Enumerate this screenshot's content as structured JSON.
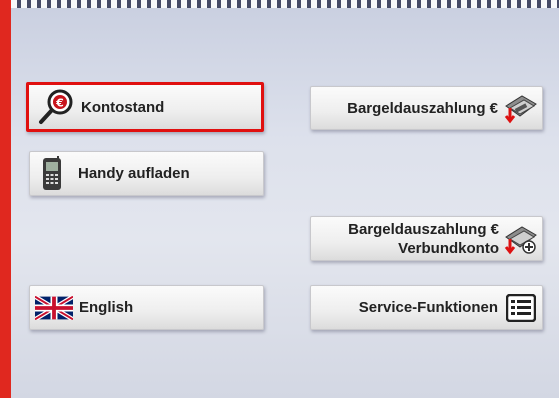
{
  "menu": {
    "kontostand": "Kontostand",
    "handy": "Handy aufladen",
    "english": "English",
    "bargeld": "Bargeldauszahlung €",
    "bargeld_verbund_line1": "Bargeldauszahlung €",
    "bargeld_verbund_line2": "Verbundkonto",
    "service": "Service-Funktionen"
  },
  "icons": {
    "kontostand": "magnifier-euro-icon",
    "handy": "mobile-phone-icon",
    "english": "uk-flag-icon",
    "bargeld": "cash-withdrawal-icon",
    "bargeld_verbund": "cash-withdrawal-linked-icon",
    "service": "list-icon"
  },
  "colors": {
    "selection": "#e01010",
    "side_bar": "#e0281f"
  }
}
